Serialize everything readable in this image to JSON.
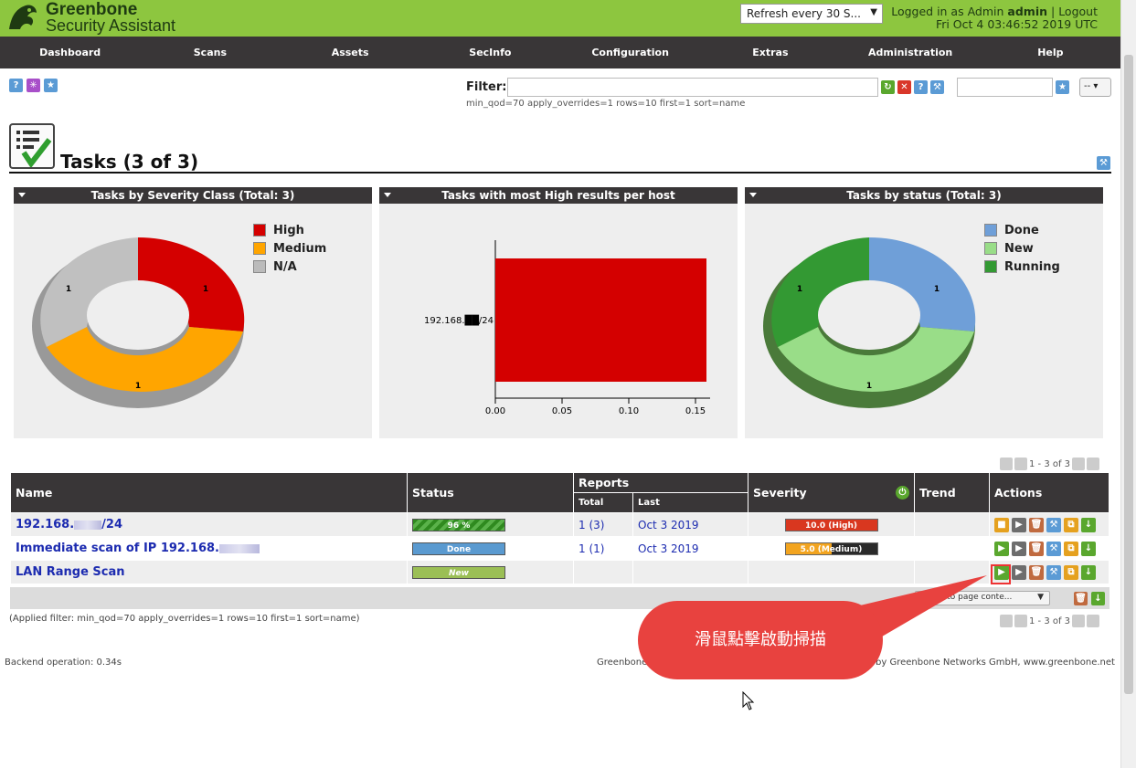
{
  "header": {
    "brand_line1": "Greenbone",
    "brand_line2": "Security Assistant",
    "refresh_select": "Refresh every 30 S...",
    "logged_in_prefix": "Logged in as",
    "role": "Admin",
    "user": "admin",
    "logout": "Logout",
    "datetime": "Fri Oct 4 03:46:52 2019 UTC"
  },
  "nav": [
    "Dashboard",
    "Scans",
    "Assets",
    "SecInfo",
    "Configuration",
    "Extras",
    "Administration",
    "Help"
  ],
  "filter": {
    "label": "Filter:",
    "value": "",
    "applied_text": "min_qod=70 apply_overrides=1 rows=10 first=1 sort=name",
    "select": "--"
  },
  "page": {
    "title": "Tasks (3 of 3)"
  },
  "panels": [
    {
      "title": "Tasks by Severity Class (Total: 3)"
    },
    {
      "title": "Tasks with most High results per host"
    },
    {
      "title": "Tasks by status (Total: 3)"
    }
  ],
  "chart_data": [
    {
      "type": "pie",
      "title": "Tasks by Severity Class (Total: 3)",
      "categories": [
        "High",
        "Medium",
        "N/A"
      ],
      "values": [
        1,
        1,
        1
      ],
      "colors": [
        "#d40000",
        "#ffa500",
        "#bbbbbb"
      ],
      "legend": "top-right"
    },
    {
      "type": "bar",
      "title": "Tasks with most High results per host",
      "categories": [
        "192.168.██/24"
      ],
      "values": [
        0.16
      ],
      "xlim": [
        0,
        0.16
      ],
      "xticks": [
        "0.00",
        "0.05",
        "0.10",
        "0.15"
      ],
      "colors": [
        "#d40000"
      ]
    },
    {
      "type": "pie",
      "title": "Tasks by status (Total: 3)",
      "categories": [
        "Done",
        "New",
        "Running"
      ],
      "values": [
        1,
        1,
        1
      ],
      "colors": [
        "#6f9fd8",
        "#99dd88",
        "#339933"
      ],
      "legend": "top-right"
    }
  ],
  "pagination": {
    "text": "1 - 3 of 3"
  },
  "table": {
    "headers": {
      "name": "Name",
      "status": "Status",
      "reports": "Reports",
      "total": "Total",
      "last": "Last",
      "severity": "Severity",
      "trend": "Trend",
      "actions": "Actions"
    },
    "rows": [
      {
        "name_pre": "192.168.",
        "name_post": "/24",
        "status": "96 %",
        "total": "1 (3)",
        "last": "Oct 3 2019",
        "severity": "10.0 (High)"
      },
      {
        "name_pre": "Immediate scan of IP 192.168.",
        "name_post": "",
        "status": "Done",
        "total": "1 (1)",
        "last": "Oct 3 2019",
        "severity": "5.0 (Medium)"
      },
      {
        "name_pre": "LAN Range Scan",
        "name_post": "",
        "status": "New",
        "total": "",
        "last": "",
        "severity": ""
      }
    ],
    "apply_select": "Apply to page conte..."
  },
  "applied_filter": "(Applied filter: min_qod=70 apply_overrides=1 rows=10 first=1 sort=name)",
  "footer": {
    "backend": "Backend operation: 0.34s",
    "copyright_start": "Greenbone",
    "copyright_end": "by Greenbone Networks GmbH, www.greenbone.net"
  },
  "annotation": "滑鼠點擊啟動掃描"
}
